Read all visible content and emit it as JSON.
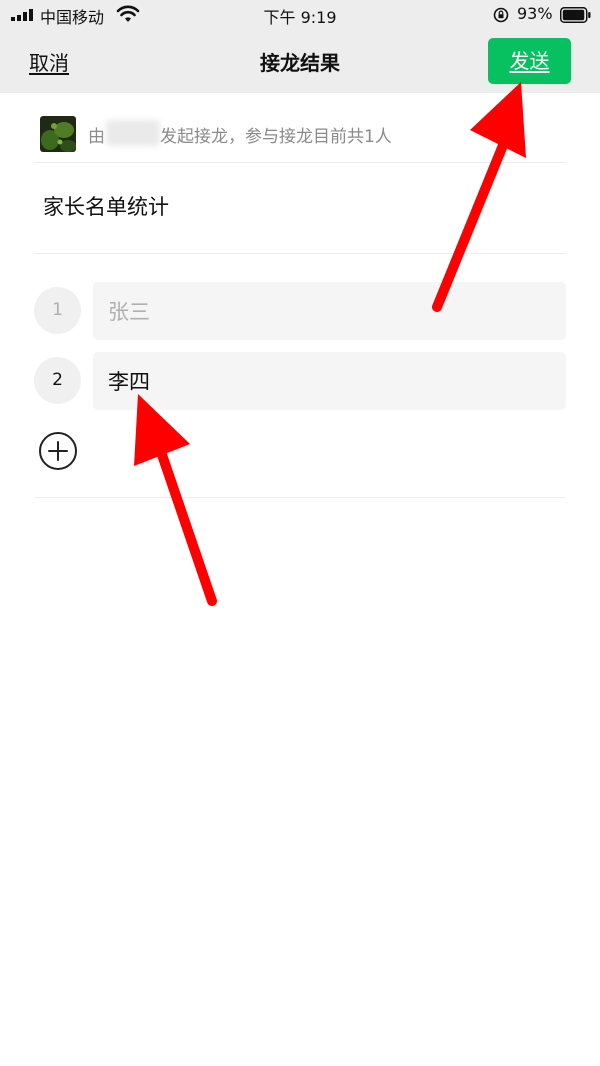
{
  "status_bar": {
    "carrier": "中国移动",
    "time": "下午 9:19",
    "battery_percent": "93%"
  },
  "nav": {
    "cancel_label": "取消",
    "title": "接龙结果",
    "send_label": "发送"
  },
  "initiator": {
    "prefix": "由",
    "suffix": "发起接龙，参与接龙目前共1人"
  },
  "list_title": "家长名单统计",
  "entries": [
    {
      "number": "1",
      "text": "张三",
      "is_placeholder": true
    },
    {
      "number": "2",
      "text": "李四",
      "is_placeholder": false
    }
  ],
  "colors": {
    "bar_bg": "#ededed",
    "send_green": "#07c160",
    "annotation_red": "#ff0000",
    "placeholder_gray": "#b0b0b0"
  }
}
